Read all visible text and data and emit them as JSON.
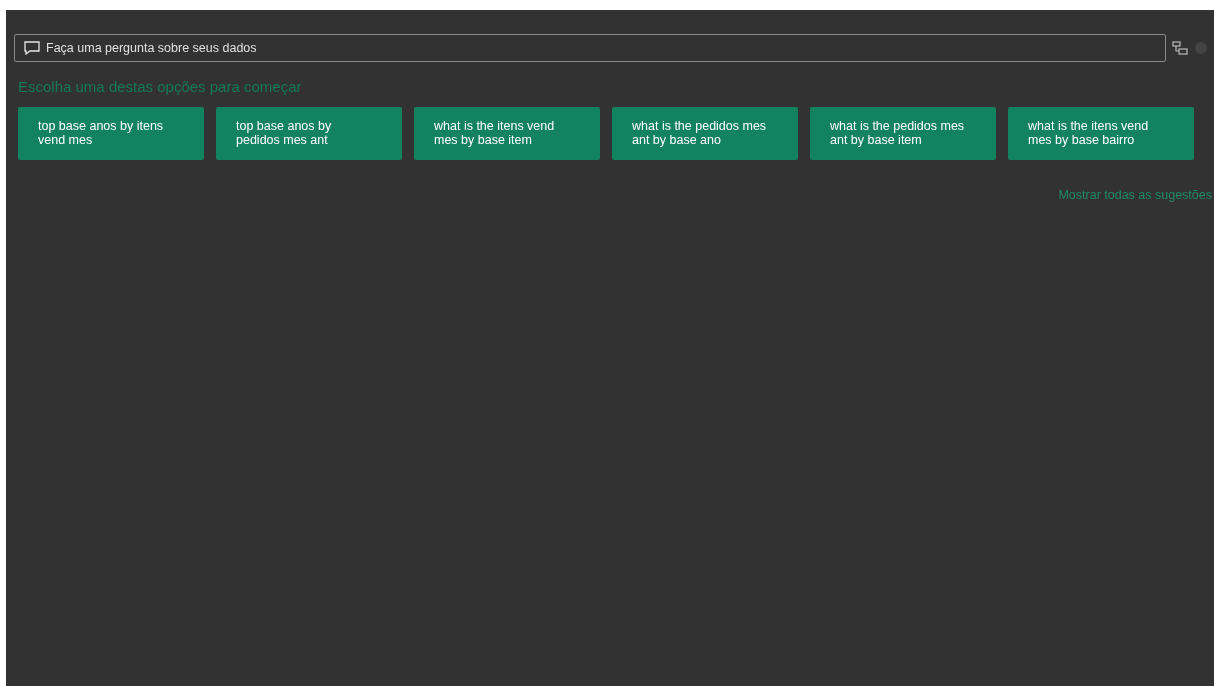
{
  "search": {
    "placeholder": "Faça uma pergunta sobre seus dados"
  },
  "heading": "Escolha uma destas opções para começar",
  "suggestions": [
    "top base anos by itens vend mes",
    "top base anos by pedidos mes ant",
    "what is the itens vend mes by base item",
    "what is the pedidos mes ant by base ano",
    "what is the pedidos mes ant by base item",
    "what is the itens vend mes by base bairro"
  ],
  "show_all": "Mostrar todas as sugestões"
}
